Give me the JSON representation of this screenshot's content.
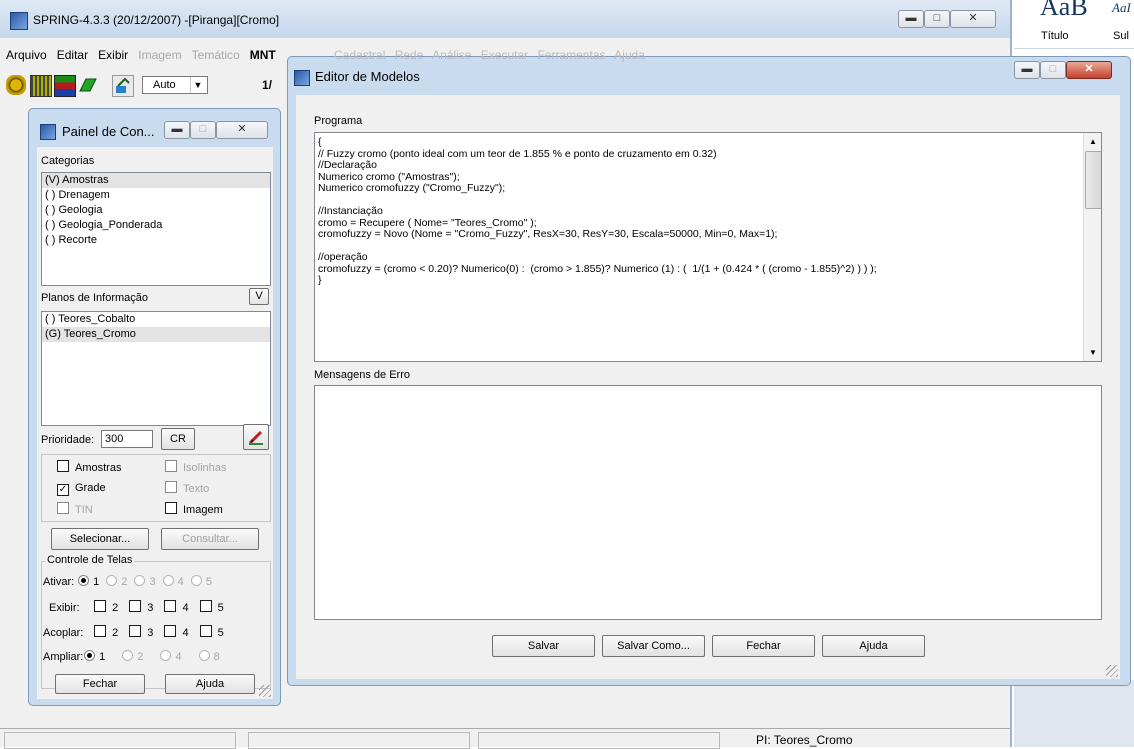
{
  "main_window": {
    "title": "SPRING-4.3.3 (20/12/2007) -[Piranga][Cromo]",
    "menu": [
      {
        "label": "Arquivo",
        "enabled": true
      },
      {
        "label": "Editar",
        "enabled": true
      },
      {
        "label": "Exibir",
        "enabled": true
      },
      {
        "label": "Imagem",
        "enabled": false
      },
      {
        "label": "Temático",
        "enabled": false
      },
      {
        "label": "MNT",
        "enabled": true
      }
    ],
    "toolbar": {
      "scale_select": "Auto",
      "scale_text": "1/"
    },
    "status": {
      "pi": "PI: Teores_Cromo"
    }
  },
  "word_ribbon": {
    "style_sample": "AaB",
    "style_sample_small": "AaI",
    "title_label": "Título",
    "subtitle_label": "Sul"
  },
  "painel": {
    "title": "Painel de Con...",
    "categorias_label": "Categorias",
    "categorias": [
      "(V) Amostras",
      "( ) Drenagem",
      "( ) Geologia",
      "( ) Geologia_Ponderada",
      "( ) Recorte"
    ],
    "planos_label": "Planos de Informação",
    "planos_button": "V",
    "planos": [
      "( ) Teores_Cobalto",
      "(G) Teores_Cromo"
    ],
    "prioridade_label": "Prioridade:",
    "prioridade_value": "300",
    "cr_button": "CR",
    "checks": {
      "amostras": "Amostras",
      "isolinhas": "Isolinhas",
      "grade": "Grade",
      "texto": "Texto",
      "tin": "TIN",
      "imagem": "Imagem"
    },
    "selecionar": "Selecionar...",
    "consultar": "Consultar...",
    "controle_label": "Controle de Telas",
    "ativar_label": "Ativar:",
    "exibir_label": "Exibir:",
    "acoplar_label": "Acoplar:",
    "ampliar_label": "Ampliar:",
    "ativar_opts": [
      "1",
      "2",
      "3",
      "4",
      "5"
    ],
    "exibir_opts": [
      "2",
      "3",
      "4",
      "5"
    ],
    "acoplar_opts": [
      "2",
      "3",
      "4",
      "5"
    ],
    "ampliar_opts": [
      "1",
      "2",
      "4",
      "8"
    ],
    "fechar": "Fechar",
    "ajuda": "Ajuda"
  },
  "editor": {
    "title": "Editor de Modelos",
    "behind_menu": [
      "Cadastral",
      "Rede",
      "Análise",
      "Executar",
      "Ferramentas",
      "Ajuda"
    ],
    "programa_label": "Programa",
    "code_lines": [
      "{",
      "// Fuzzy cromo (ponto ideal com um teor de 1.855 % e ponto de cruzamento em 0.32)",
      "//Declaração",
      "Numerico cromo (\"Amostras\");",
      "Numerico cromofuzzy (\"Cromo_Fuzzy\");",
      "",
      "//Instanciação",
      "cromo = Recupere ( Nome= \"Teores_Cromo\" );",
      "cromofuzzy = Novo (Nome = \"Cromo_Fuzzy\", ResX=30, ResY=30, Escala=50000, Min=0, Max=1);",
      "",
      "//operação",
      "cromofuzzy = (cromo < 0.20)? Numerico(0) :  (cromo > 1.855)? Numerico (1) : (  1/(1 + (0.424 * ( (cromo - 1.855)^2) ) ) );",
      "}"
    ],
    "mensagens_label": "Mensagens de Erro",
    "buttons": {
      "salvar": "Salvar",
      "salvar_como": "Salvar Como...",
      "fechar": "Fechar",
      "ajuda": "Ajuda"
    }
  },
  "colors": {
    "accent_blue": "#3a6ea5",
    "window_frame": "#c9dbee",
    "panel_bg": "#f0f0f0"
  }
}
